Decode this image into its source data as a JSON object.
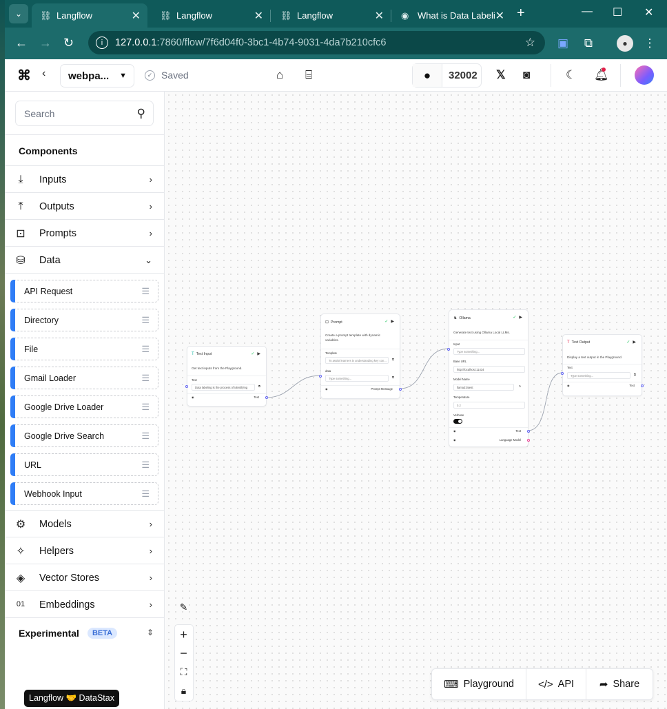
{
  "browser": {
    "tabs": [
      {
        "title": "Langflow",
        "active": true
      },
      {
        "title": "Langflow",
        "active": false
      },
      {
        "title": "Langflow",
        "active": false
      },
      {
        "title": "What is Data Labeli",
        "active": false
      }
    ],
    "url_host": "127.0.0.1",
    "url_path": ":7860/flow/7f6d04f0-3bc1-4b74-9031-4da7b210cfc6"
  },
  "header": {
    "project_name": "webpa...",
    "save_status": "Saved",
    "github_stars": "32002"
  },
  "sidebar": {
    "search_placeholder": "Search",
    "components_title": "Components",
    "categories_top": [
      {
        "label": "Inputs"
      },
      {
        "label": "Outputs"
      },
      {
        "label": "Prompts"
      },
      {
        "label": "Data"
      }
    ],
    "data_items": [
      "API Request",
      "Directory",
      "File",
      "Gmail Loader",
      "Google Drive Loader",
      "Google Drive Search",
      "URL",
      "Webhook Input"
    ],
    "categories_bottom": [
      {
        "label": "Models"
      },
      {
        "label": "Helpers"
      },
      {
        "label": "Vector Stores"
      },
      {
        "label": "Embeddings"
      }
    ],
    "experimental_label": "Experimental",
    "experimental_badge": "BETA",
    "brand_badge": "Langflow 🤝 DataStax"
  },
  "nodes": {
    "text_input": {
      "title": "Text Input",
      "description": "Get text inputs from the Playground.",
      "field_label": "Text",
      "field_value": "Data labeling is the process of identifying",
      "output_label": "Text"
    },
    "prompt": {
      "title": "Prompt",
      "description": "Create a prompt template with dynamic variables.",
      "template_label": "Template",
      "template_value": "To assist learners in understanding key con...",
      "data_label": "data",
      "data_placeholder": "Type something...",
      "output_label": "Prompt Message"
    },
    "ollama": {
      "title": "Ollama",
      "description": "Generate text using Ollama Local LLMs.",
      "input_label": "Input",
      "input_placeholder": "Type something...",
      "base_url_label": "Base URL",
      "base_url_value": "http://localhost:11434",
      "model_label": "Model Name",
      "model_value": "llama3:latest",
      "temperature_label": "Temperature",
      "temperature_value": "0.2",
      "verbose_label": "Verbose",
      "output_text_label": "Text",
      "output_model_label": "Language Model"
    },
    "text_output": {
      "title": "Text Output",
      "description": "Display a text output in the Playground.",
      "field_label": "Text",
      "field_placeholder": "Type something...",
      "output_label": "Text"
    }
  },
  "actions": {
    "playground": "Playground",
    "api": "API",
    "share": "Share"
  },
  "colors": {
    "browser_frame": "#0f5a5a",
    "accent_blue": "#2f7df6",
    "edge_handle": "#6366f1"
  }
}
